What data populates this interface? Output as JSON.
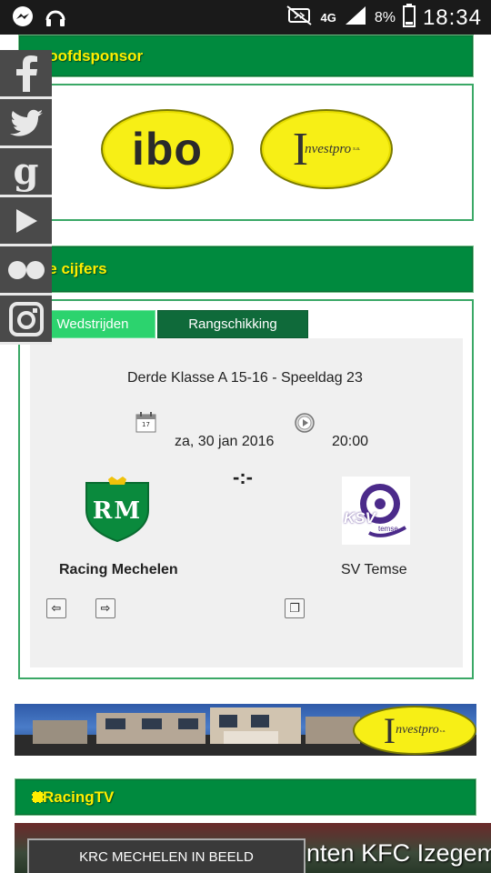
{
  "statusbar": {
    "network": "4G",
    "battery": "8%",
    "time": "18:34",
    "icons": [
      "messenger-icon",
      "headset-icon",
      "nfc-icon",
      "signal-icon",
      "battery-icon"
    ]
  },
  "sponsor_section": {
    "title": "Hoofdsponsor",
    "sponsors": [
      {
        "name": "ibo",
        "text": "ibo"
      },
      {
        "name": "investpro",
        "initial": "I",
        "text": "nvestpro",
        "suffix": "s.a."
      }
    ]
  },
  "stats_section": {
    "title": "De cijfers",
    "tabs": [
      "Wedstrijden",
      "Rangschikking"
    ],
    "active_tab": 0,
    "match": {
      "competition": "Derde Klasse A 15-16 - Speeldag 23",
      "date": "za, 30 jan 2016",
      "time": "20:00",
      "calendar_day": "17",
      "score": "-:-",
      "home_team": "Racing Mechelen",
      "home_logo_text": "RM",
      "away_team": "SV Temse",
      "away_logo_text": "KSV",
      "away_logo_sub": "temse"
    }
  },
  "banner": {
    "initial": "I",
    "text": "nvestpro",
    "suffix": "s.a."
  },
  "tv_section": {
    "title": "RacingTV",
    "video_label": "KRC MECHELEN IN BEELD",
    "video_ticker": "unten KFC Izegem"
  },
  "social": [
    "facebook-icon",
    "twitter-icon",
    "google-icon",
    "youtube-icon",
    "flickr-icon",
    "instagram-icon"
  ],
  "colors": {
    "header_green": "#008a3e",
    "title_yellow": "#ffee00",
    "panel_border": "#3aa866",
    "tab_active": "#2cd36e",
    "tab_inactive": "#0f6a3a",
    "sponsor_yellow": "#f7ef16",
    "social_bg": "#4a4a4a"
  }
}
